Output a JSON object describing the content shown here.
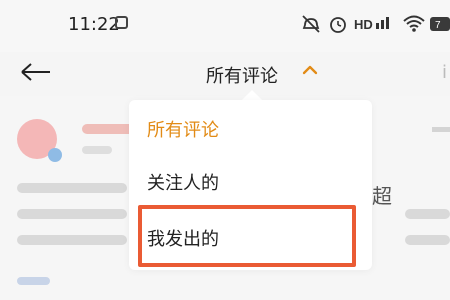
{
  "status_bar": {
    "time": "11:22",
    "icons": [
      "square-outline-icon",
      "mute-icon",
      "alarm-icon",
      "hd-icon",
      "wifi-icon",
      "battery-icon"
    ],
    "hd_label": "HD",
    "battery_label": "7"
  },
  "header": {
    "title": "所有评论",
    "title_caret_icon": "chevron-up-icon",
    "right_cut_text": "i"
  },
  "feed": {
    "visible_snippet": "超"
  },
  "dropdown": {
    "items": [
      {
        "label": "所有评论",
        "active": true
      },
      {
        "label": "关注人的",
        "active": false
      },
      {
        "label": "我发出的",
        "active": false
      }
    ]
  },
  "colors": {
    "accent": "#e28b16",
    "highlight": "#ea5b34",
    "background": "#f3f3f3"
  }
}
